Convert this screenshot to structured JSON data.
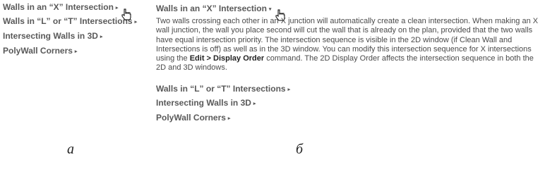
{
  "panel_a": {
    "items": [
      {
        "label": "Walls in an “X” Intersection"
      },
      {
        "label": "Walls in “L” or “T” Intersections"
      },
      {
        "label": "Intersecting Walls in 3D"
      },
      {
        "label": "PolyWall Corners"
      }
    ],
    "caption": "а"
  },
  "panel_b": {
    "expanded_item": {
      "label": "Walls in an “X” Intersection"
    },
    "description": {
      "text_before": "Two walls crossing each other in an X junction will automatically create a clean intersection. When making an X wall junction, the wall you place second will cut the wall that is already on the plan, provided that the two walls have equal intersection priority. The intersection sequence is visible in the 2D window (if Clean Wall and Intersections is off) as well as in the 3D window. You can modify this intersection sequence for X intersections using the ",
      "command_path": "Edit > Display Order",
      "text_after": " command. The 2D Display Order affects the intersection sequence in both the 2D and 3D windows."
    },
    "items": [
      {
        "label": "Walls in “L” or “T” Intersections"
      },
      {
        "label": "Intersecting Walls in 3D"
      },
      {
        "label": "PolyWall Corners"
      }
    ],
    "caption": "б"
  },
  "icons": {
    "collapsed_arrow": "▸",
    "expanded_arrow": "▾",
    "pointer": "hand-pointer-icon"
  }
}
